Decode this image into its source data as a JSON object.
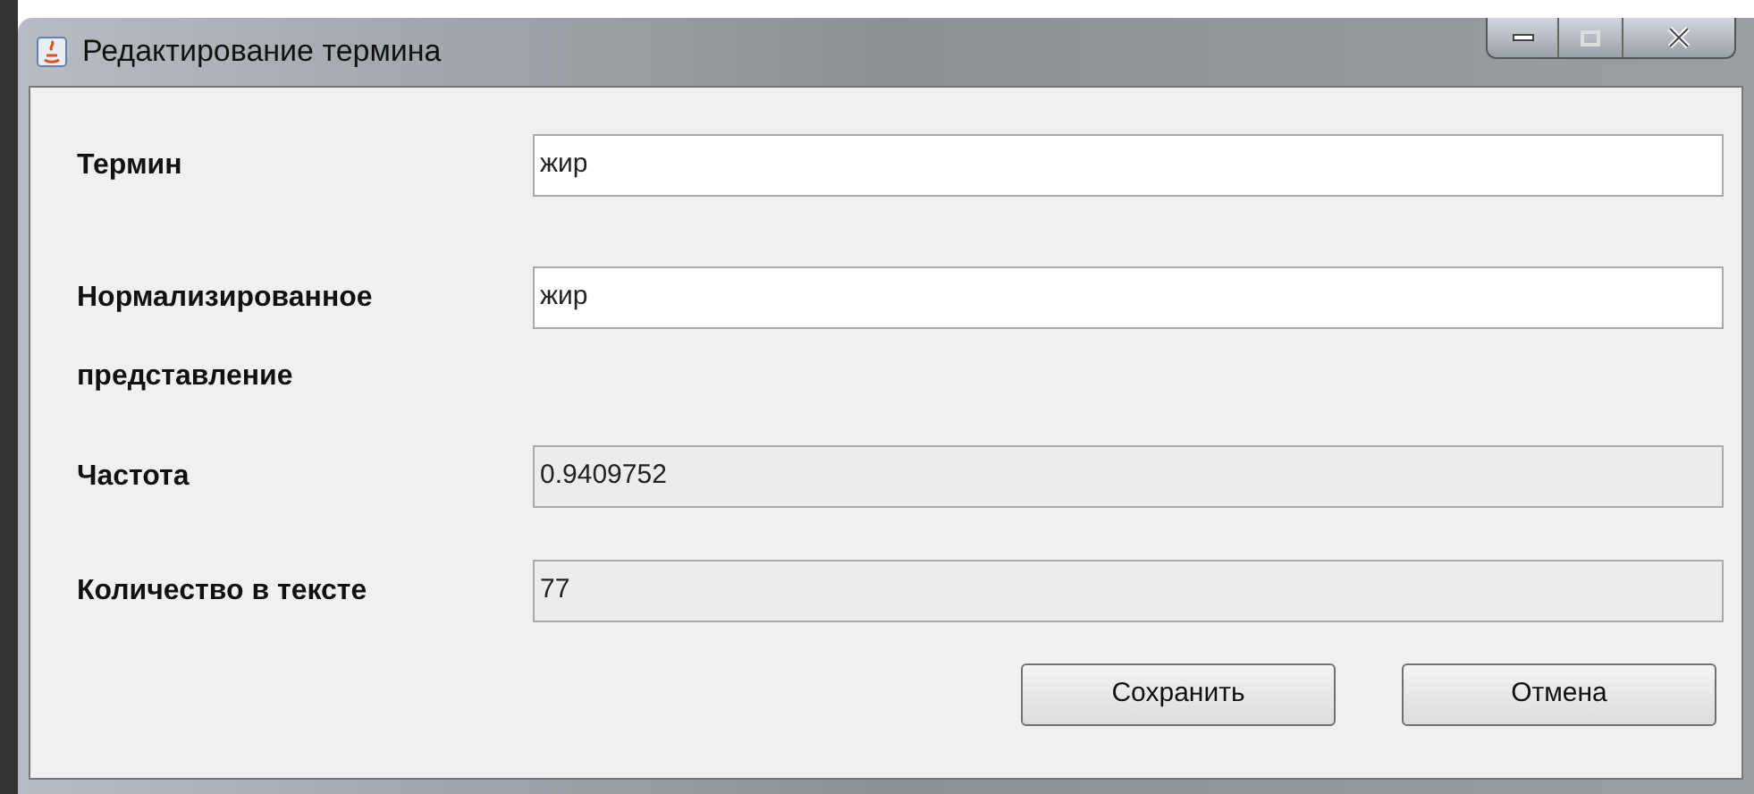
{
  "window": {
    "title": "Редактирование термина"
  },
  "fields": [
    {
      "label": "Термин",
      "value": "жир",
      "editable": true
    },
    {
      "label": "Нормализированное представление",
      "value": "жир",
      "editable": true
    },
    {
      "label": "Частота",
      "value": "0.9409752",
      "editable": false
    },
    {
      "label": "Количество в тексте",
      "value": "77",
      "editable": false
    }
  ],
  "buttons": [
    "Сохранить",
    "Отмена"
  ]
}
